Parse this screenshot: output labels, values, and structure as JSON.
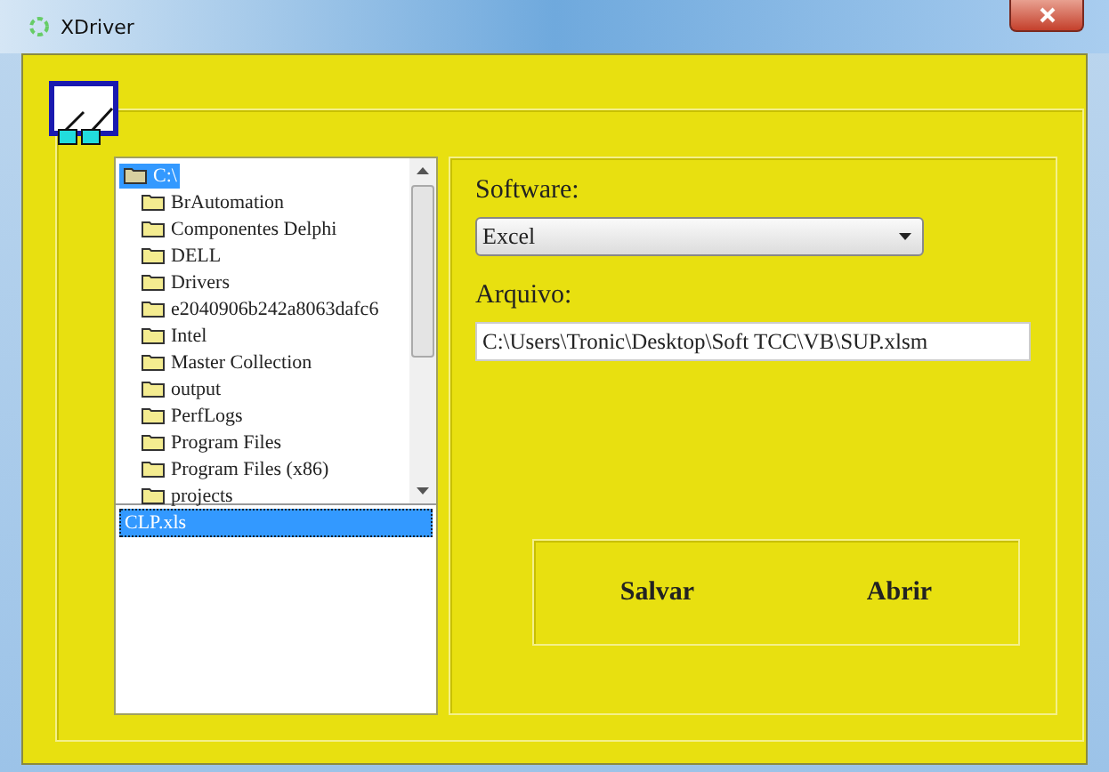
{
  "window": {
    "title": "XDriver"
  },
  "directory_tree": {
    "items": [
      {
        "label": "C:\\",
        "selected": true,
        "expanded": true,
        "children": [
          {
            "label": "BrAutomation",
            "selected": false
          },
          {
            "label": "Componentes Delphi",
            "selected": false
          },
          {
            "label": "DELL",
            "selected": false
          },
          {
            "label": "Drivers",
            "selected": false
          },
          {
            "label": "e2040906b242a8063dafc6",
            "selected": false
          },
          {
            "label": "Intel",
            "selected": false
          },
          {
            "label": "Master Collection",
            "selected": false
          },
          {
            "label": "output",
            "selected": false
          },
          {
            "label": "PerfLogs",
            "selected": false
          },
          {
            "label": "Program Files",
            "selected": false
          },
          {
            "label": "Program Files (x86)",
            "selected": false
          },
          {
            "label": "projects",
            "selected": false
          }
        ]
      }
    ]
  },
  "file_list": {
    "items": [
      {
        "label": "CLP.xls",
        "selected": true
      }
    ]
  },
  "software": {
    "label": "Software:",
    "value": "Excel"
  },
  "file": {
    "label": "Arquivo:",
    "value": "C:\\Users\\Tronic\\Desktop\\Soft TCC\\VB\\SUP.xlsm"
  },
  "buttons": [
    "Salvar",
    "Abrir"
  ]
}
